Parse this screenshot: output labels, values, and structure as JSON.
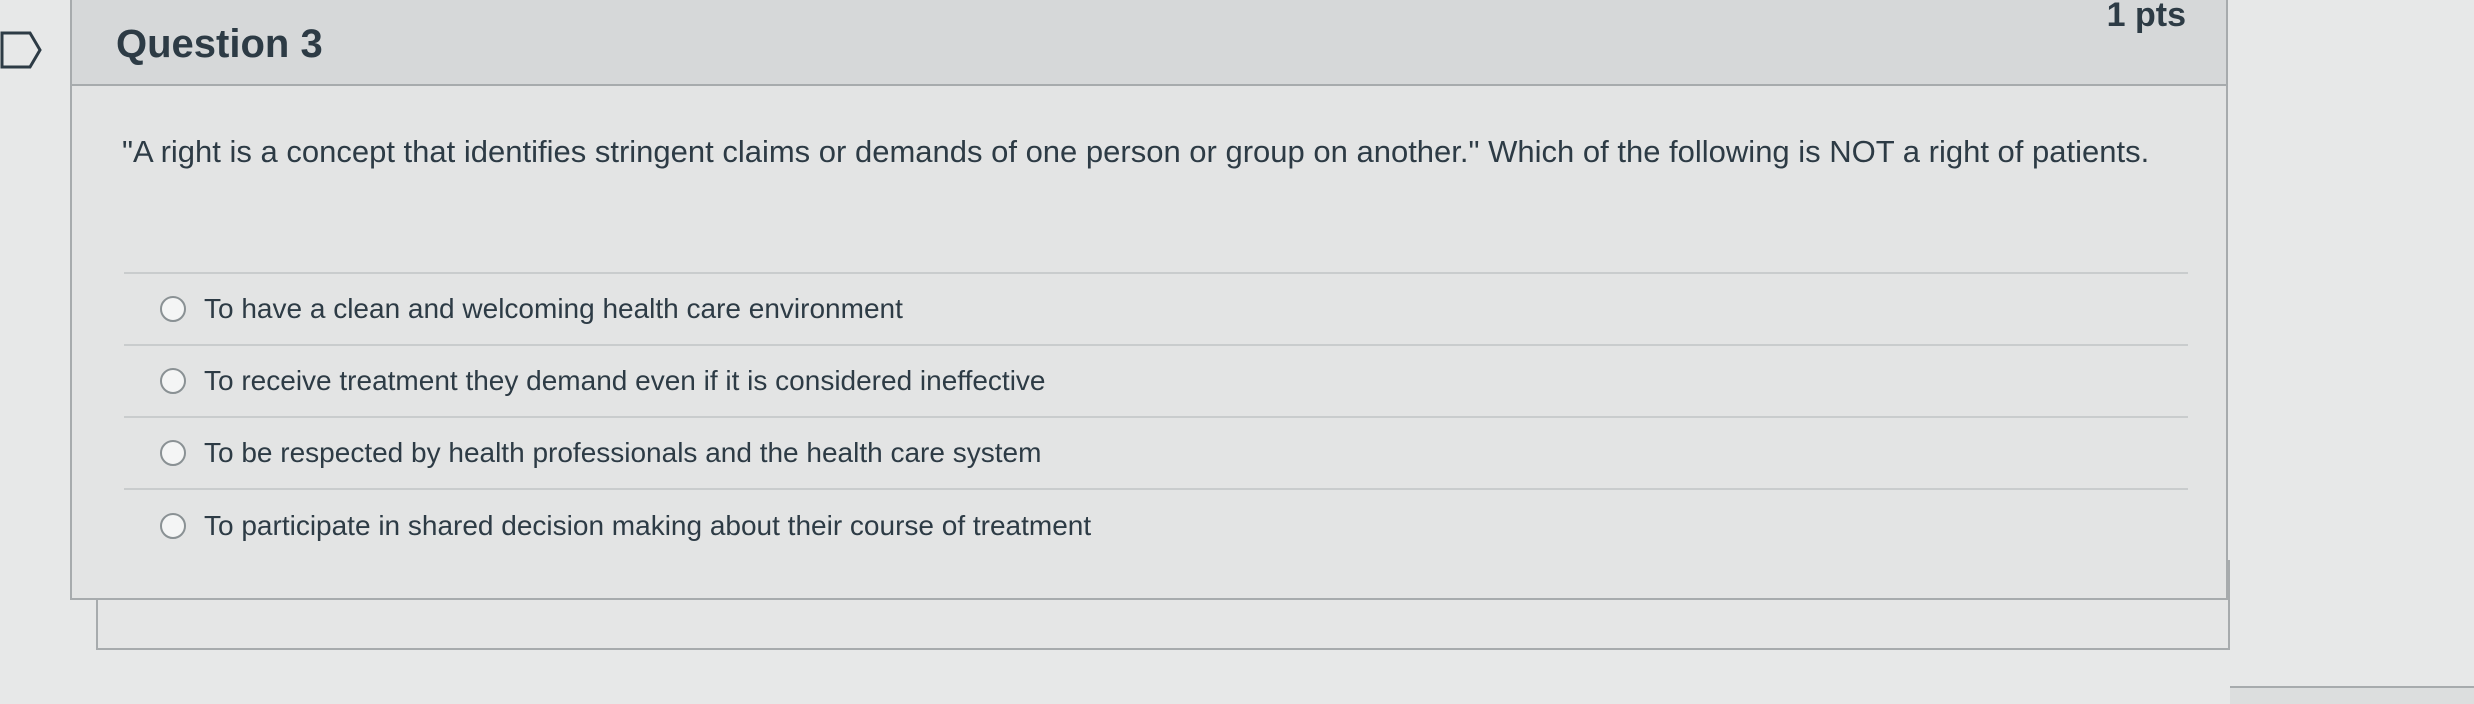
{
  "question": {
    "title": "Question 3",
    "points": "1 pts",
    "text": "\"A right is a concept that identifies stringent claims or demands of one person or group on another.\" Which of the following is NOT a right of patients."
  },
  "answers": [
    {
      "label": "To have a clean and welcoming health care environment"
    },
    {
      "label": "To receive treatment they demand even if it is considered ineffective"
    },
    {
      "label": "To be respected by health professionals and the health care system"
    },
    {
      "label": "To participate in shared decision making about their course of treatment"
    }
  ],
  "icons": {
    "flag": "bookmark-flag-icon",
    "radio": "radio-button-icon"
  },
  "colors": {
    "text": "#2d3b45",
    "header_bg": "#d6d8d9",
    "border": "#a7abad"
  }
}
